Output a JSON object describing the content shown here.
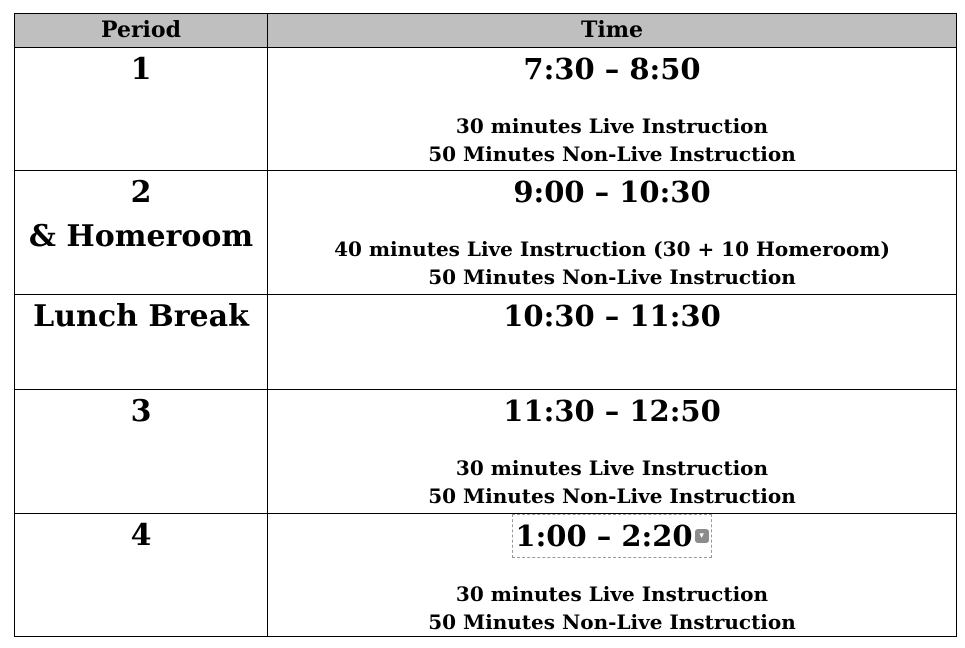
{
  "header": {
    "period": "Period",
    "time": "Time"
  },
  "rows": [
    {
      "period_lines": [
        "1"
      ],
      "time": "7:30 – 8:50",
      "notes": [
        "30 minutes Live Instruction",
        "50 Minutes Non-Live Instruction"
      ]
    },
    {
      "period_lines": [
        "2",
        "& Homeroom"
      ],
      "time": "9:00 – 10:30",
      "notes": [
        "40 minutes Live Instruction (30 + 10 Homeroom)",
        "50 Minutes Non-Live Instruction"
      ]
    },
    {
      "period_lines": [
        "Lunch Break"
      ],
      "time": "10:30 – 11:30",
      "notes": []
    },
    {
      "period_lines": [
        "3"
      ],
      "time": "11:30 – 12:50",
      "notes": [
        "30 minutes Live Instruction",
        "50 Minutes Non-Live Instruction"
      ]
    },
    {
      "period_lines": [
        "4"
      ],
      "time": "1:00 – 2:20",
      "notes": [
        "30 minutes Live Instruction",
        "50 Minutes Non-Live Instruction"
      ]
    }
  ],
  "icons": {
    "field_dropdown": "chevron-down-icon"
  },
  "colors": {
    "header_bg": "#bfbfbf",
    "border": "#000000"
  }
}
